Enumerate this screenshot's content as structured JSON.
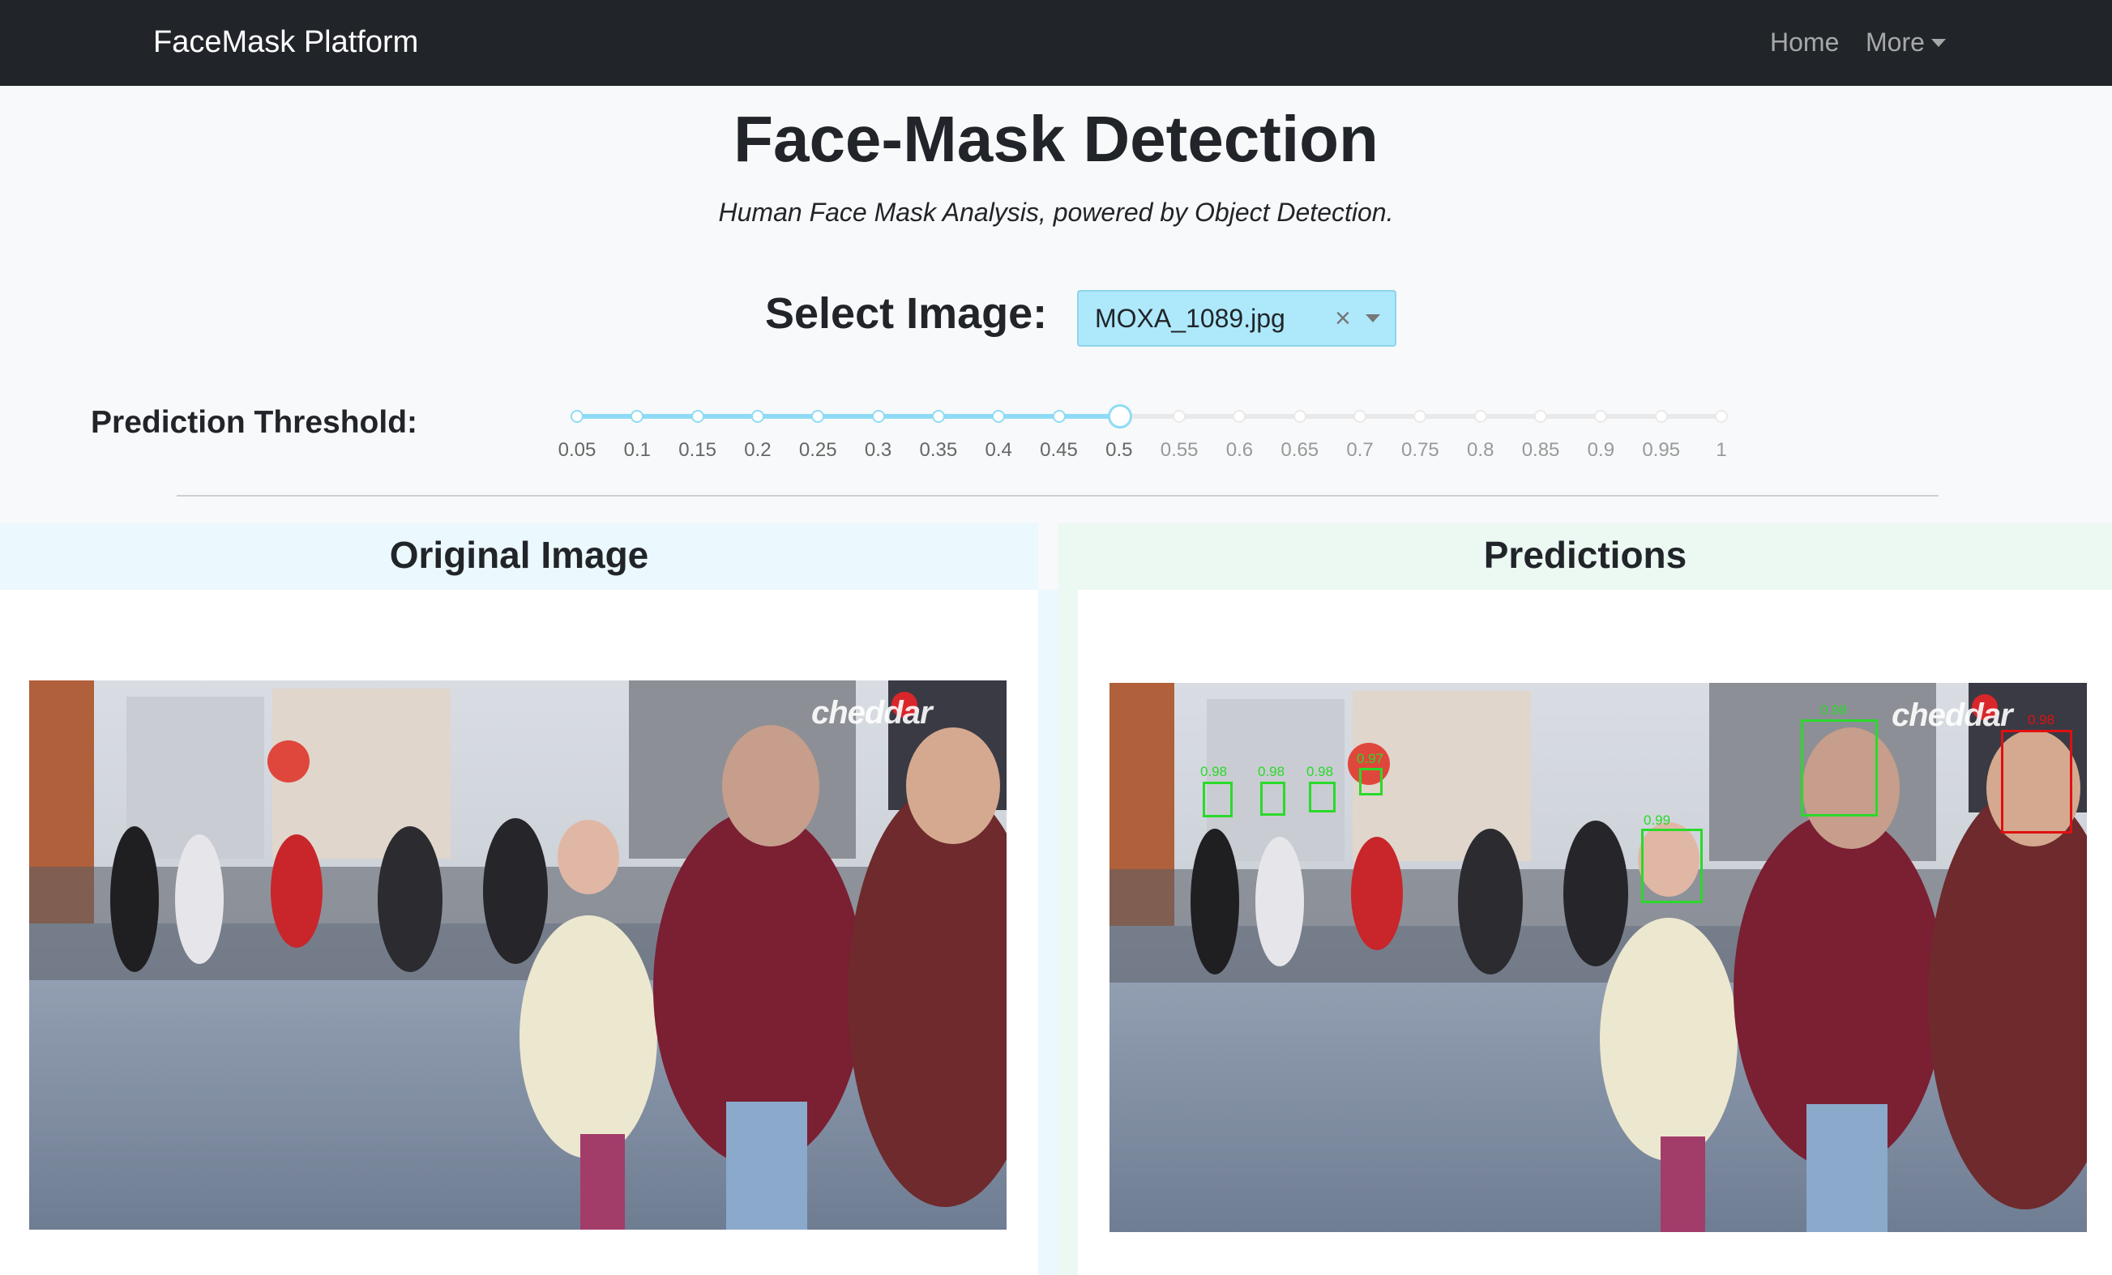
{
  "navbar": {
    "brand": "FaceMask Platform",
    "links": [
      {
        "label": "Home"
      },
      {
        "label": "More",
        "dropdown": true
      }
    ]
  },
  "header": {
    "title": "Face-Mask Detection",
    "subtitle": "Human Face Mask Analysis, powered by Object Detection."
  },
  "image_select": {
    "label": "Select Image:",
    "value": "MOXA_1089.jpg",
    "clear_icon": "×"
  },
  "threshold": {
    "label": "Prediction Threshold:",
    "value": 0.5,
    "marks": [
      "0.05",
      "0.1",
      "0.15",
      "0.2",
      "0.25",
      "0.3",
      "0.35",
      "0.4",
      "0.45",
      "0.5",
      "0.55",
      "0.6",
      "0.65",
      "0.7",
      "0.75",
      "0.8",
      "0.85",
      "0.9",
      "0.95",
      "1"
    ]
  },
  "panels": {
    "original_title": "Original Image",
    "predictions_title": "Predictions",
    "watermark": "cheddar"
  },
  "predictions": [
    {
      "score": "0.98",
      "label": "mask"
    },
    {
      "score": "0.98",
      "label": "mask"
    },
    {
      "score": "0.98",
      "label": "mask"
    },
    {
      "score": "0.97",
      "label": "mask"
    },
    {
      "score": "0.99",
      "label": "mask"
    },
    {
      "score": "0.98",
      "label": "mask"
    },
    {
      "score": "0.98",
      "label": "no-mask"
    }
  ],
  "colors": {
    "navbar": "#212529",
    "mask_box": "#2bd92b",
    "no_mask_box": "#e01010",
    "slider_accent": "#8fdbf5"
  }
}
